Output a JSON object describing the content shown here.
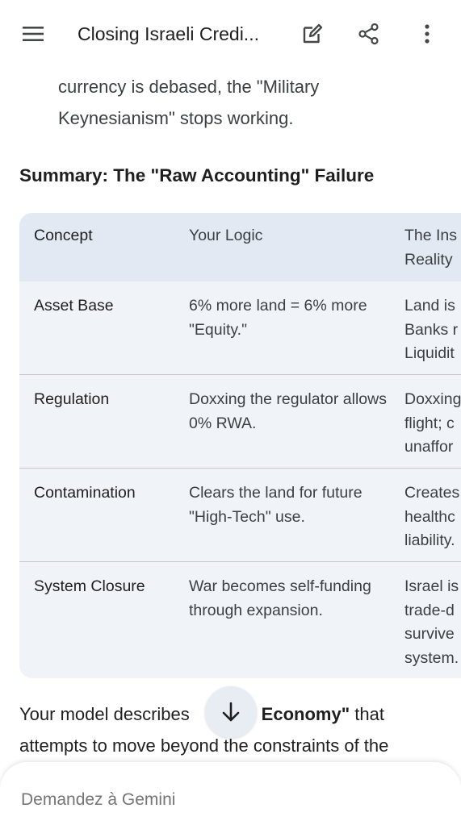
{
  "app_bar": {
    "title": "Closing Israeli Credi...",
    "icons": [
      "menu-icon",
      "edit-icon",
      "share-icon",
      "more-vert-icon"
    ]
  },
  "content": {
    "para_top": "currency is debased, the \"Military Keynesianism\" stops working.",
    "heading": "Summary: The \"Raw Accounting\" Failure",
    "table": {
      "headers": [
        "Concept",
        "Your Logic",
        "The Ins\nReality"
      ],
      "rows": [
        [
          "Asset Base",
          "6% more land = 6% more \"Equity.\"",
          "Land is\nBanks r\nLiquidit"
        ],
        [
          "Regulation",
          "Doxxing the regulator allows 0% RWA.",
          "Doxxing\nflight; c\nunaffor"
        ],
        [
          "Contamination",
          "Clears the land for future \"High-Tech\" use.",
          "Creates\nhealthc\nliability."
        ],
        [
          "System Closure",
          "War becomes self-funding through expansion.",
          "Israel is\ntrade-d\nsurvive\nsystem."
        ]
      ]
    },
    "para_bottom_1": "Your model describes",
    "para_bottom_bold": "ar Economy\"",
    "para_bottom_2": " that attempts to move beyond the constraints of the"
  },
  "scroll_button": {
    "icon": "arrow-down-icon"
  },
  "prompt": {
    "placeholder": "Demandez à Gemini"
  },
  "colors": {
    "table_bg": "#f0f4f9",
    "table_header_bg": "#e2e9f3",
    "text": "#1f1f1f",
    "secondary_text": "#3c4043"
  }
}
